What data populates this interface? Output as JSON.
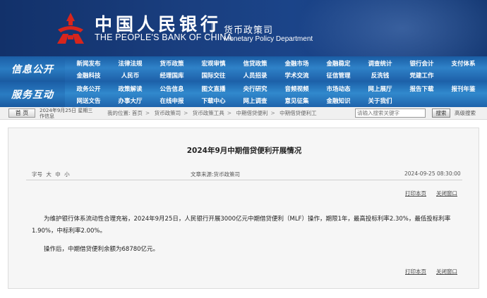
{
  "header": {
    "bank_name_cn": "中国人民银行",
    "bank_name_en": "THE PEOPLE'S BANK OF CHINA",
    "dept_cn": "货币政策司",
    "dept_en": "Monetary Policy Department",
    "logo_icon": "pboc-logo-icon",
    "colors": {
      "banner": "#1a3f80",
      "nav": "#2a79c0",
      "logo_red": "#d7251c"
    }
  },
  "nav1": {
    "title": "信息公开",
    "row1": [
      "新闻发布",
      "法律法规",
      "货币政策",
      "宏观审慎",
      "信贷政策",
      "金融市场",
      "金融稳定",
      "调查统计",
      "银行会计",
      "支付体系"
    ],
    "row2": [
      "金融科技",
      "人民币",
      "经理国库",
      "国际交往",
      "人员招录",
      "学术交流",
      "征信管理",
      "反洗钱",
      "党建工作"
    ]
  },
  "nav2": {
    "title": "服务互动",
    "row1": [
      "政务公开",
      "政策解读",
      "公告信息",
      "图文直播",
      "央行研究",
      "音频视频",
      "市场动态",
      "网上展厅",
      "报告下载",
      "报刊年鉴"
    ],
    "row2": [
      "网送文告",
      "办事大厅",
      "在线申报",
      "下载中心",
      "网上调查",
      "意见征集",
      "金融知识",
      "关于我们"
    ]
  },
  "breadcrumb": {
    "home_label": "首 页",
    "date_line1": "2024年9月25日 星期三",
    "date_line2": "作信息",
    "location_label": "我的位置:",
    "items": [
      "首页",
      "货币政策司",
      "货币政策工具",
      "中期借贷便利",
      "中期借贷便利工"
    ]
  },
  "search": {
    "placeholder": "请输入搜索关键字",
    "button_label": "搜索",
    "advanced_label": "高级搜索"
  },
  "article": {
    "title": "2024年9月中期借贷便利开展情况",
    "font_size_label": "字号",
    "font_sizes": [
      "大",
      "中",
      "小"
    ],
    "source": "文章来源:货币政策司",
    "timestamp": "2024-09-25 08:30:00",
    "print_label": "打印本页",
    "close_label": "关闭窗口",
    "paragraph1": "为维护银行体系流动性合理充裕，2024年9月25日，人民银行开展3000亿元中期借贷便利（MLF）操作，期限1年，最高投标利率2.30%，最低投标利率1.90%，中标利率2.00%。",
    "paragraph2": "操作后，中期借贷便利余额为68780亿元。"
  }
}
